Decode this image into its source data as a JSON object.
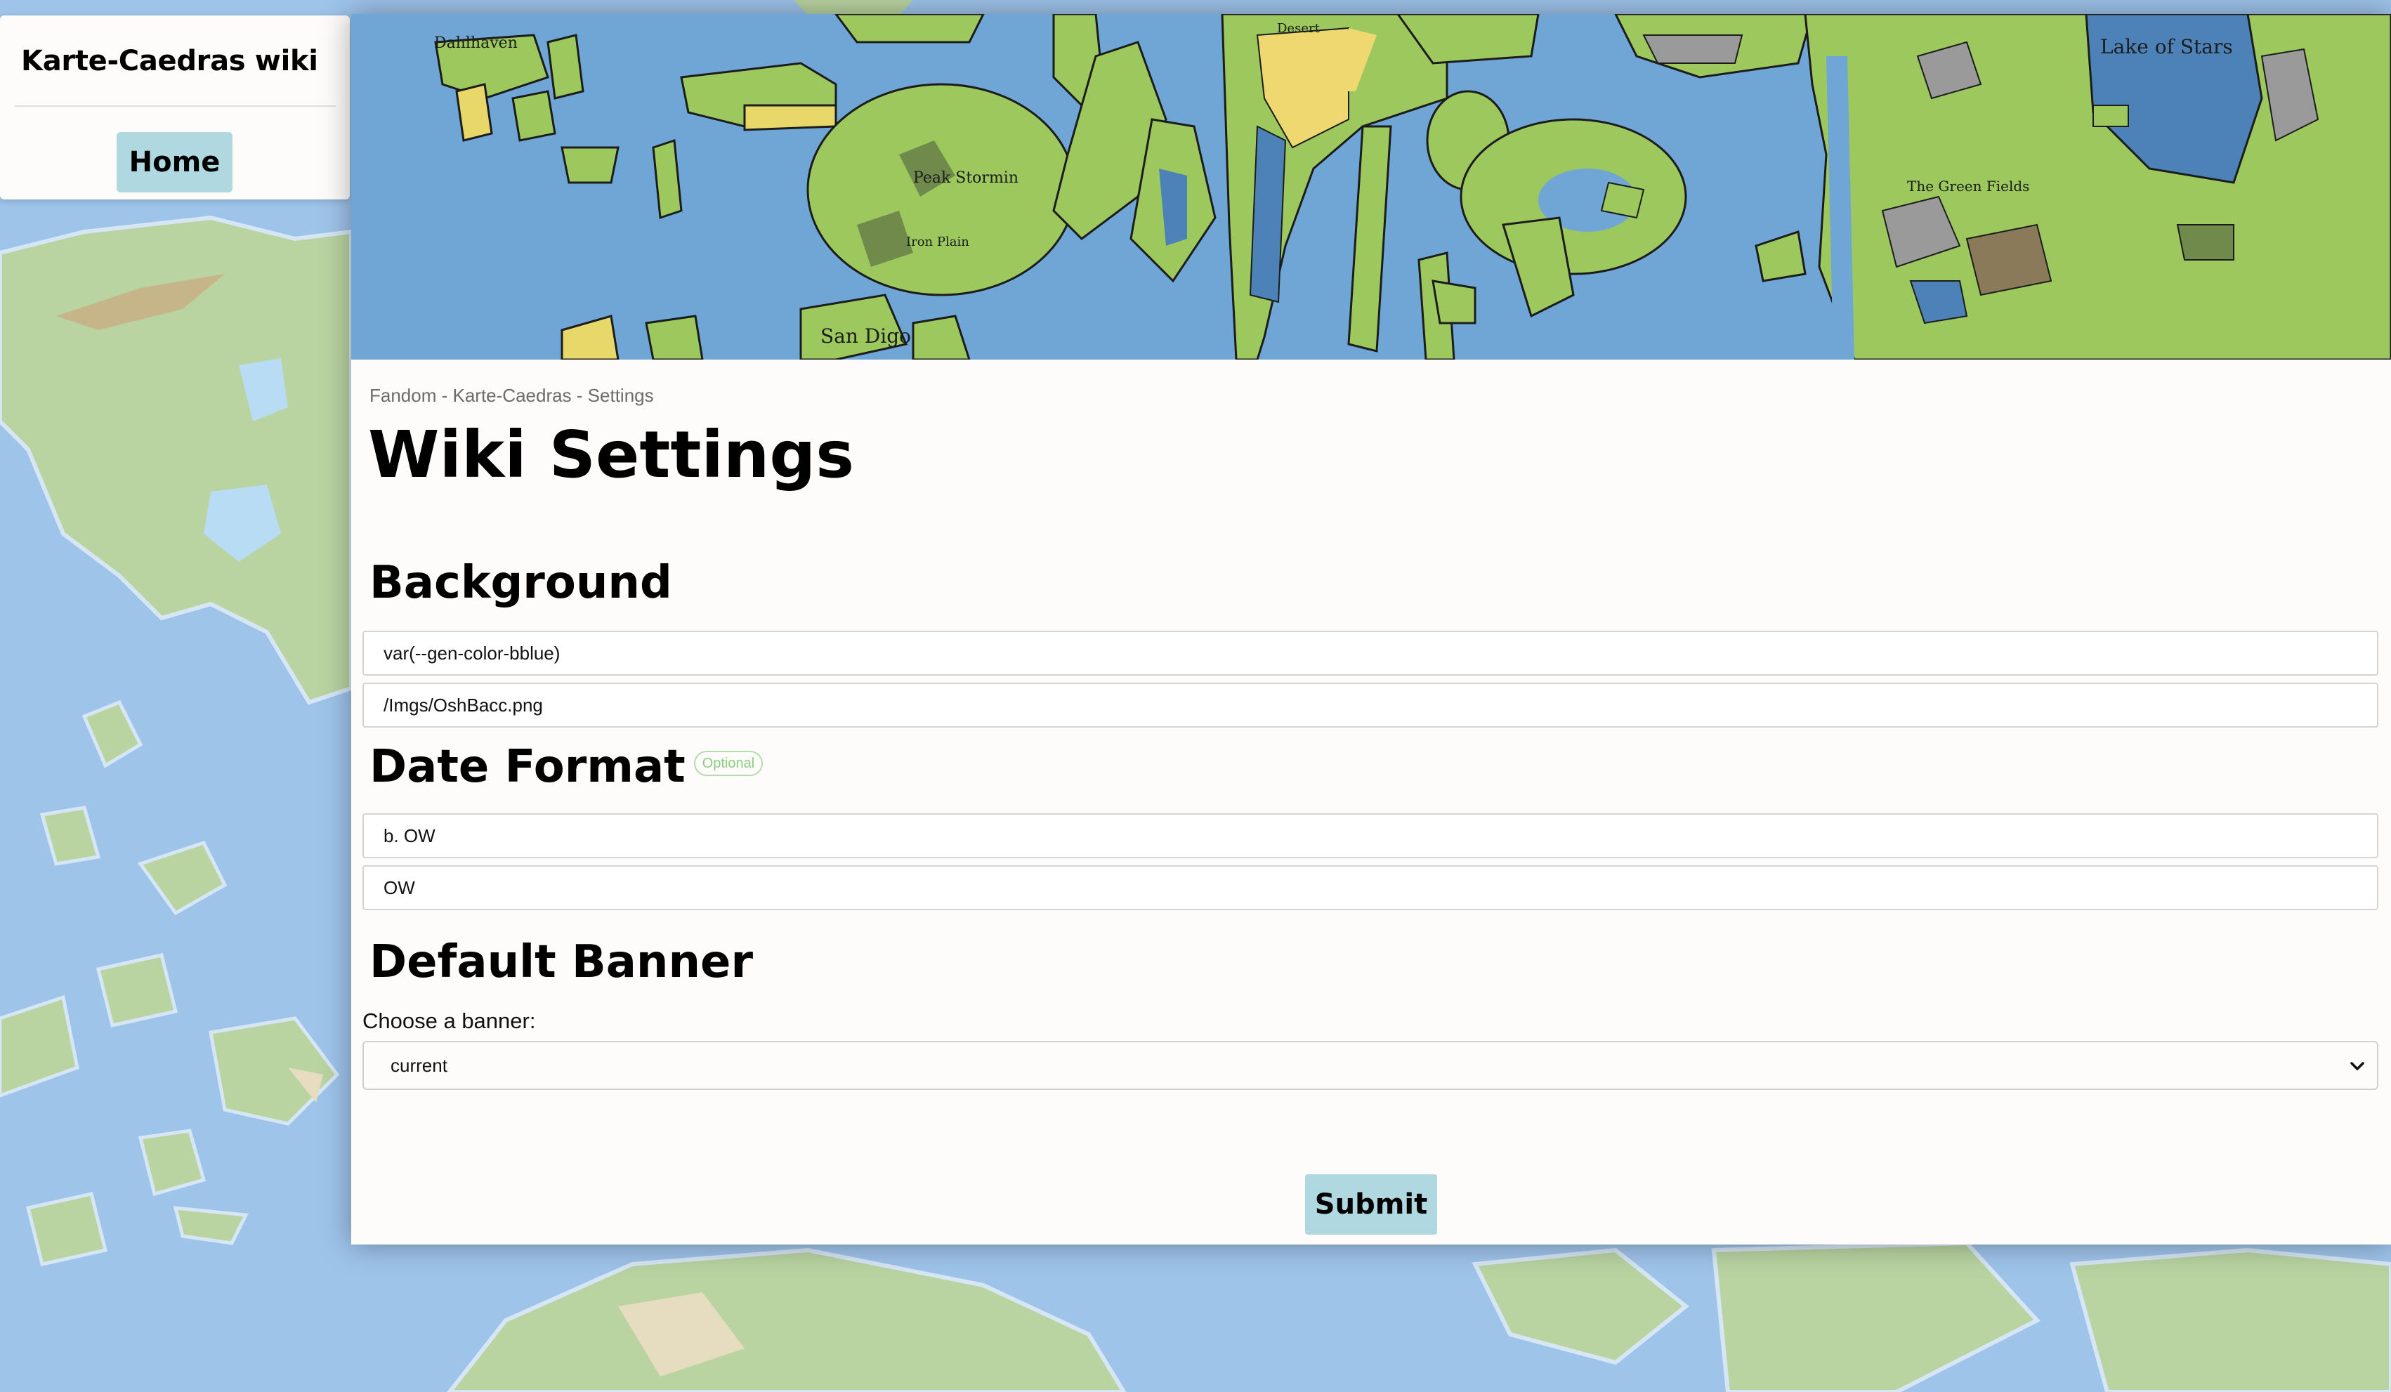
{
  "sidebar": {
    "wiki_title": "Karte-Caedras wiki",
    "home_label": "Home"
  },
  "breadcrumb": "Fandom - Karte-Caedras - Settings",
  "page_title": "Wiki Settings",
  "sections": {
    "background": {
      "heading": "Background",
      "color_value": "var(--gen-color-bblue)",
      "image_value": "/Imgs/OshBacc.png"
    },
    "date_format": {
      "heading": "Date Format",
      "badge": "Optional",
      "before_value": "b. OW",
      "after_value": "OW"
    },
    "default_banner": {
      "heading": "Default Banner",
      "label": "Choose a banner:",
      "selected": "current"
    }
  },
  "submit_label": "Submit",
  "banner_labels": {
    "dahlhaven": "Dahlhaven",
    "san_digo": "San Digo",
    "desert": "Desert",
    "lake_of_stars": "Lake of Stars",
    "the_green_fields": "The Green Fields",
    "iron_plain": "Iron Plain",
    "peak_stormin": "Peak Stormin"
  },
  "colors": {
    "accent_button": "#b0d8e0",
    "page_background": "#9ec4ea",
    "panel_background": "#fdfcfa",
    "optional_badge": "#8ccc80"
  },
  "icons": {
    "select_chevron": "chevron-down-icon"
  }
}
